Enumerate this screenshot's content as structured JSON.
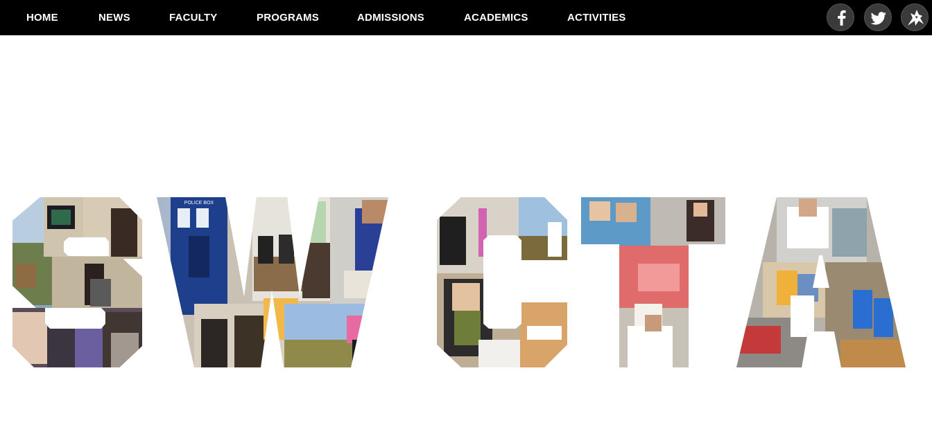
{
  "nav": {
    "items": [
      {
        "label": "HOME"
      },
      {
        "label": "NEWS"
      },
      {
        "label": "FACULTY"
      },
      {
        "label": "PROGRAMS"
      },
      {
        "label": "ADMISSIONS"
      },
      {
        "label": "ACADEMICS"
      },
      {
        "label": "ACTIVITIES"
      }
    ]
  },
  "social": {
    "icons": [
      "facebook-icon",
      "twitter-icon",
      "mustang-logo-icon"
    ]
  },
  "hero": {
    "wordmark": "SWCTA",
    "tardis_sign": "POLICE BOX"
  },
  "colors": {
    "navbar_bg": "#000000",
    "nav_text": "#ffffff",
    "page_bg": "#ffffff",
    "social_bg": "#3a3a3a"
  }
}
